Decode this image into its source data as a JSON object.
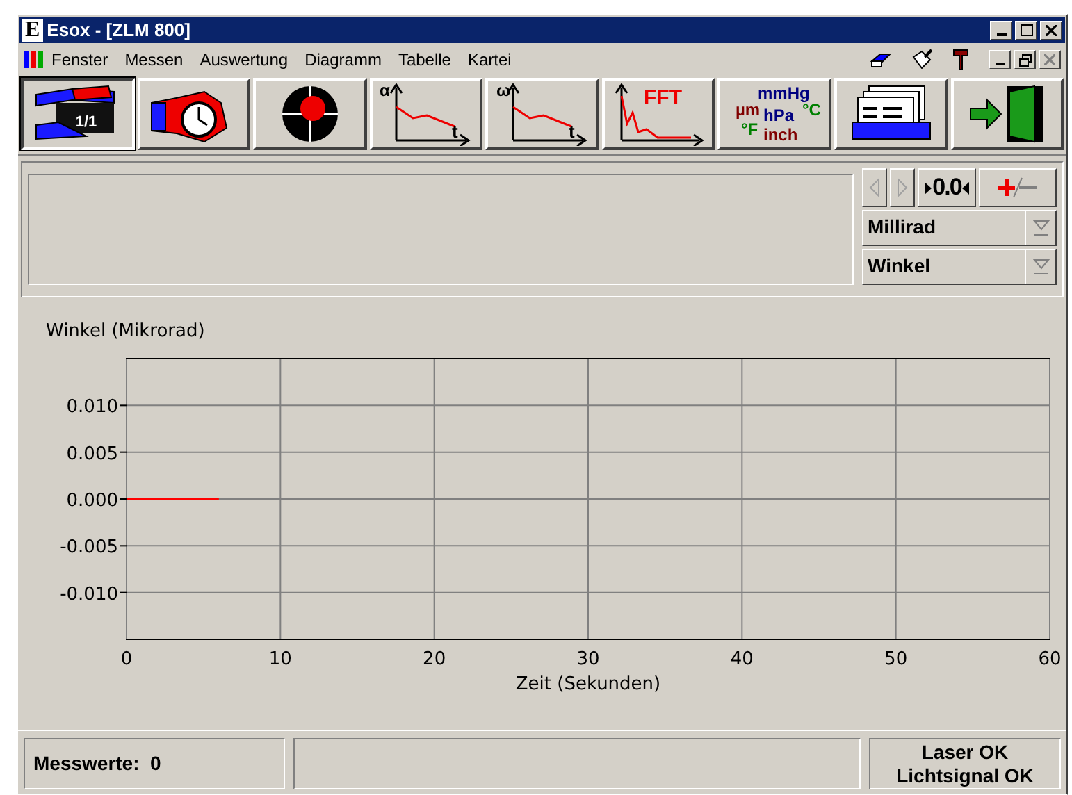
{
  "window": {
    "logo": "E",
    "title": "Esox - [ZLM 800]"
  },
  "menu": [
    {
      "label": "Fenster"
    },
    {
      "label": "Messen"
    },
    {
      "label": "Auswertung"
    },
    {
      "label": "Diagramm"
    },
    {
      "label": "Tabelle"
    },
    {
      "label": "Kartei"
    }
  ],
  "toolbar": [
    {
      "kind": "measure",
      "texts": [
        "1/1"
      ],
      "selected": true
    },
    {
      "kind": "stopwatch",
      "selected": false
    },
    {
      "kind": "target",
      "selected": false
    },
    {
      "kind": "plot",
      "texts": [
        "α",
        "t"
      ],
      "selected": false
    },
    {
      "kind": "plot",
      "texts": [
        "ω",
        "t"
      ],
      "selected": false
    },
    {
      "kind": "fft",
      "texts": [
        "FFT"
      ],
      "selected": false
    },
    {
      "kind": "units",
      "texts": [
        "mmHg",
        "µm",
        "hPa",
        "°C",
        "°F",
        "inch"
      ],
      "selected": false
    },
    {
      "kind": "cards",
      "selected": false
    },
    {
      "kind": "exit",
      "selected": false
    }
  ],
  "panel": {
    "nav": [
      {
        "kind": "prev",
        "disabled": true
      },
      {
        "kind": "next",
        "disabled": true
      }
    ],
    "zero_button": "0.0",
    "dropdowns": [
      {
        "value": "Millirad"
      },
      {
        "value": "Winkel"
      }
    ]
  },
  "chart": {
    "chart_data": {
      "type": "line",
      "xlabel": "Zeit (Sekunden)",
      "ylabel": "Winkel (Mikrorad)",
      "xlim": [
        0,
        60
      ],
      "ylim": [
        -0.015,
        0.015
      ],
      "xticks": [
        0,
        10,
        20,
        30,
        40,
        50,
        60
      ],
      "yticks": [
        {
          "value": 0.01,
          "label": "0.010"
        },
        {
          "value": 0.005,
          "label": "0.005"
        },
        {
          "value": 0,
          "label": "0.000"
        },
        {
          "value": -0.005,
          "label": "-0.005"
        },
        {
          "value": -0.01,
          "label": "-0.010"
        }
      ],
      "x": [
        0,
        6
      ],
      "grid": true,
      "series": [
        {
          "color": "#ff0000",
          "values": [
            0,
            0
          ]
        }
      ]
    }
  },
  "status": {
    "count": "Messwerte:  0",
    "laser": "Laser OK",
    "signal": "Lichtsignal OK"
  }
}
